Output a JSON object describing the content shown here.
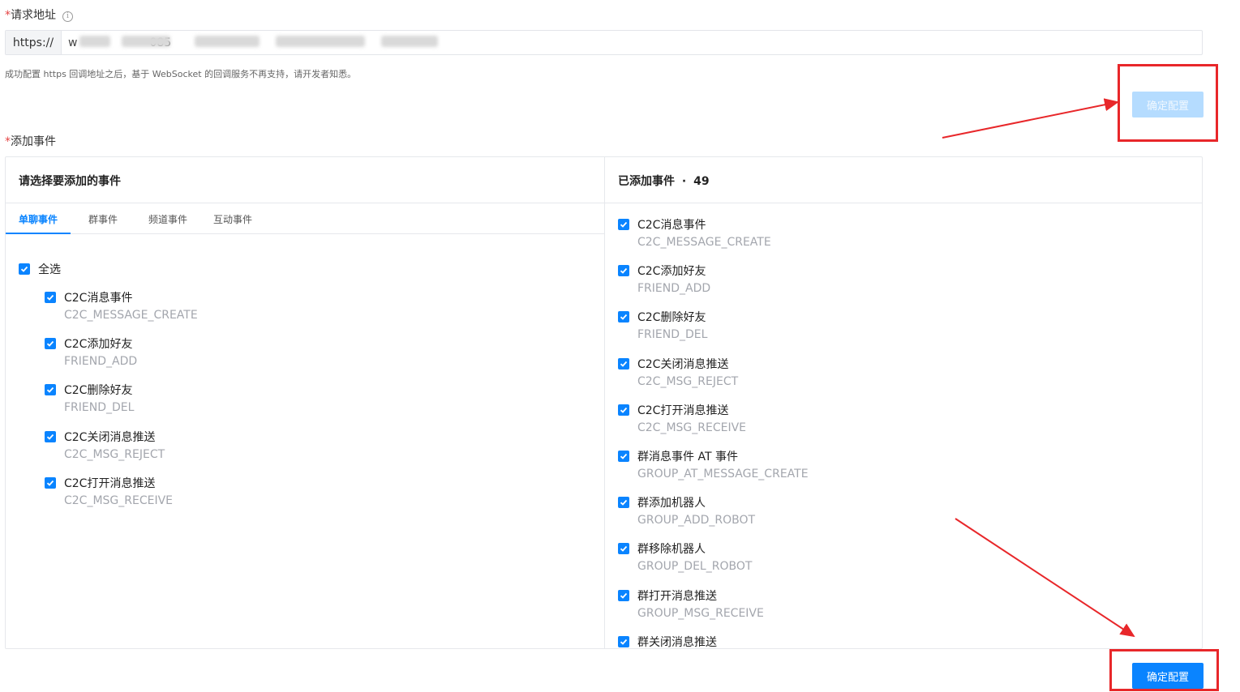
{
  "url_section": {
    "required_mark": "*",
    "label": "请求地址",
    "info_icon": "info-icon",
    "prefix": "https://",
    "value": "w                    085",
    "hint": "成功配置 https 回调地址之后，基于 WebSocket 的回调服务不再支持，请开发者知悉。"
  },
  "top_confirm_button": "确定配置",
  "events_section": {
    "required_mark": "*",
    "label": "添加事件"
  },
  "left_panel": {
    "title": "请选择要添加的事件",
    "tabs": [
      "单聊事件",
      "群事件",
      "频道事件",
      "互动事件"
    ],
    "active_tab": 0,
    "select_all": "全选",
    "events": [
      {
        "title": "C2C消息事件",
        "code": "C2C_MESSAGE_CREATE"
      },
      {
        "title": "C2C添加好友",
        "code": "FRIEND_ADD"
      },
      {
        "title": "C2C删除好友",
        "code": "FRIEND_DEL"
      },
      {
        "title": "C2C关闭消息推送",
        "code": "C2C_MSG_REJECT"
      },
      {
        "title": "C2C打开消息推送",
        "code": "C2C_MSG_RECEIVE"
      }
    ]
  },
  "right_panel": {
    "title": "已添加事件",
    "separator": "·",
    "count": "49",
    "events": [
      {
        "title": "C2C消息事件",
        "code": "C2C_MESSAGE_CREATE"
      },
      {
        "title": "C2C添加好友",
        "code": "FRIEND_ADD"
      },
      {
        "title": "C2C删除好友",
        "code": "FRIEND_DEL"
      },
      {
        "title": "C2C关闭消息推送",
        "code": "C2C_MSG_REJECT"
      },
      {
        "title": "C2C打开消息推送",
        "code": "C2C_MSG_RECEIVE"
      },
      {
        "title": "群消息事件 AT 事件",
        "code": "GROUP_AT_MESSAGE_CREATE"
      },
      {
        "title": "群添加机器人",
        "code": "GROUP_ADD_ROBOT"
      },
      {
        "title": "群移除机器人",
        "code": "GROUP_DEL_ROBOT"
      },
      {
        "title": "群打开消息推送",
        "code": "GROUP_MSG_RECEIVE"
      },
      {
        "title": "群关闭消息推送",
        "code": ""
      }
    ]
  },
  "bottom_confirm_button": "确定配置",
  "colors": {
    "primary": "#0a84ff",
    "disabled_button": "#b5dcff",
    "annotation_red": "#e8272a",
    "required_star": "#e54545"
  }
}
